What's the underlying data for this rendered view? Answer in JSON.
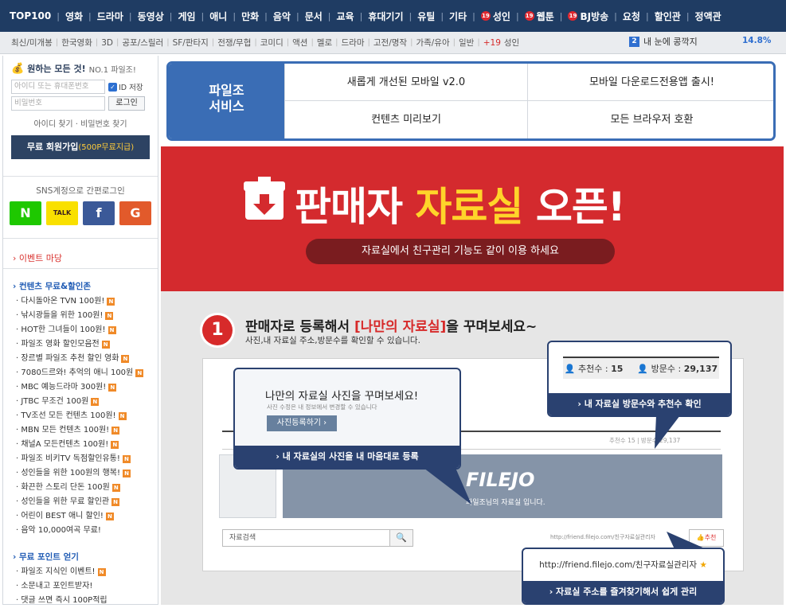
{
  "topnav": [
    "TOP100",
    "영화",
    "드라마",
    "동영상",
    "게임",
    "애니",
    "만화",
    "음악",
    "문서",
    "교육",
    "휴대기기",
    "유틸",
    "기타",
    "성인",
    "웹툰",
    "BJ방송",
    "요청",
    "할인관",
    "정액관"
  ],
  "badge19": "19",
  "subnav": [
    "최신/미개봉",
    "한국영화",
    "3D",
    "공포/스릴러",
    "SF/판타지",
    "전쟁/무협",
    "코미디",
    "액션",
    "멜로",
    "드라마",
    "고전/명작",
    "가족/유아",
    "일반",
    "+19",
    "성인"
  ],
  "ranking": {
    "num": "2",
    "text": "내 눈에 콩깍지",
    "pct": "14.8%"
  },
  "login": {
    "slogan": "원하는 모든 것!",
    "slogan_sub": "NO.1 파일조!",
    "id_placeholder": "아이디 또는 휴대폰번호",
    "pw_placeholder": "비밀번호",
    "save_id": "ID 저장",
    "login_btn": "로그인",
    "find": "아이디 찾기 · 비밀번호 찾기",
    "join": "무료 회원가입",
    "join_bonus": "(500P무료지급)"
  },
  "sns": {
    "title": "SNS계정으로 간편로그인",
    "buttons": [
      "N",
      "TALK",
      "f",
      "G"
    ],
    "colors": [
      "#1ec800",
      "#f9e000",
      "#3b5998",
      "#e25a2b"
    ]
  },
  "event": "› 이벤트 마당",
  "sections": [
    {
      "title": "› 컨텐츠 무료&할인존",
      "items": [
        {
          "label": "다시돌아온 TVN 100원!",
          "new": true
        },
        {
          "label": "낚시광들을 위한 100원!",
          "new": true
        },
        {
          "label": "HOT한 그녀들이 100원!",
          "new": true
        },
        {
          "label": "파일조 영화 할인모음전",
          "new": true
        },
        {
          "label": "장르별 파일조 추천 할인 영화",
          "new": true
        },
        {
          "label": "7080드르와! 추억의 애니 100원",
          "new": true
        },
        {
          "label": "MBC 예능드라마 300원!",
          "new": true
        },
        {
          "label": "JTBC 무조건 100원",
          "new": true
        },
        {
          "label": "TV조선 모든 컨텐츠 100원!",
          "new": true
        },
        {
          "label": "MBN 모든 컨텐츠 100원!",
          "new": true
        },
        {
          "label": "채널A 모든컨텐츠 100원!",
          "new": true
        },
        {
          "label": "파일조 비키TV 독점할인유통!",
          "new": true
        },
        {
          "label": "성인들을 위한 100원의 행복!",
          "new": true
        },
        {
          "label": "화끈한 스토리 단돈 100원",
          "new": true
        },
        {
          "label": "성인들을 위한 무료 할인관",
          "new": true
        },
        {
          "label": "어린이 BEST 애니 할인!",
          "new": true
        },
        {
          "label": "음악 10,000여곡 무료!",
          "new": false
        }
      ]
    },
    {
      "title": "› 무료 포인트 얻기",
      "items": [
        {
          "label": "파일조 지식인 이벤트!",
          "new": true
        },
        {
          "label": "소문내고 포인트받자!",
          "new": false
        },
        {
          "label": "댓글 쓰면 즉시 100P적립",
          "new": false
        }
      ]
    }
  ],
  "new_badge": "N",
  "service": {
    "label": "파일조\n서비스",
    "cells": [
      "새롭게 개선된 모바일 v2.0",
      "모바일 다운로드전용앱 출시!",
      "컨텐츠 미리보기",
      "모든 브라우저 호환"
    ]
  },
  "banner": {
    "title_a": "판매자",
    "title_b": "자료실",
    "title_c": "오픈!",
    "subtitle": "자료실에서 친구관리 기능도 같이 이용 하세요"
  },
  "guide": {
    "step": "1",
    "title_a": "판매자로 등록해서",
    "title_b": "[나만의 자료실]",
    "title_c": "을 꾸며보세요~",
    "subtitle": "사진,내 자료실 주소,방문수를 확인할 수 있습니다.",
    "mock": {
      "stats": "추천수 15  |  방문수 29,137",
      "logo": "FILEJO",
      "caption": "파일조님의 자료실 입니다.",
      "search": "자료검색",
      "url": "http://friend.filejo.com/친구자료실관리자",
      "rec": "추천"
    },
    "callout1": {
      "heading": "나만의 자료실 사진을 꾸며보세요!",
      "sub": "사진 수정은 내 정보에서 변경할 수 있습니다",
      "button": "사진등록하기 ›",
      "footer": "› 내 자료실의 사진을 내 마음대로 등록"
    },
    "callout2": {
      "rec_label": "추천수 :",
      "rec_value": "15",
      "visit_label": "방문수 :",
      "visit_value": "29,137",
      "footer": "› 내 자료실 방문수와 추천수 확인"
    },
    "callout3": {
      "url": "http://friend.filejo.com/친구자료실관리자",
      "footer": "› 자료실 주소를 즐겨찾기해서 쉽게 관리"
    }
  }
}
